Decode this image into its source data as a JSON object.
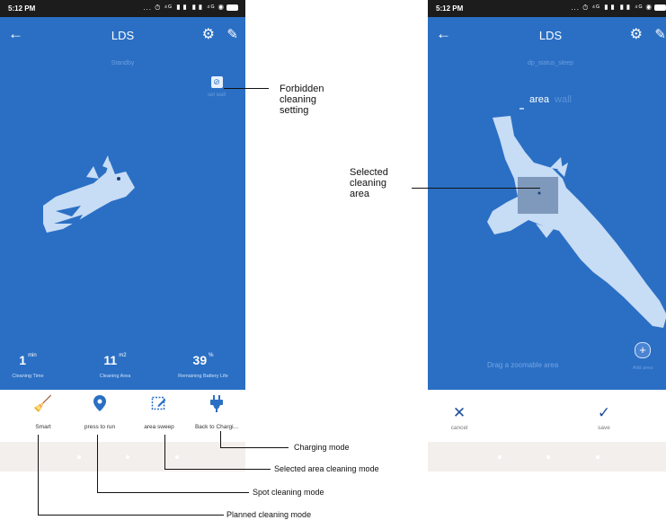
{
  "left_phone": {
    "status_bar": {
      "time": "5:12 PM",
      "icons": "... ⏱ ⁴ᴳ ▮▮ ▮▮ ⁴ᴳ ◉"
    },
    "title_bar": {
      "title": "LDS"
    },
    "status_text": "Standby",
    "set_wall_label": "set wall",
    "stats": [
      {
        "value": "1",
        "unit": "min",
        "label": "Cleaning Time"
      },
      {
        "value": "11",
        "unit": "m2",
        "label": "Cleaning Area"
      },
      {
        "value": "39",
        "unit": "%",
        "label": "Remaining Battery Life"
      }
    ],
    "modes": [
      {
        "label": "Smart",
        "icon": "broom-icon"
      },
      {
        "label": "press to run",
        "icon": "location-pin-icon"
      },
      {
        "label": "area sweep",
        "icon": "area-edit-icon"
      },
      {
        "label": "Back to Chargi...",
        "icon": "plug-icon"
      }
    ]
  },
  "right_phone": {
    "status_bar": {
      "time": "5:12 PM",
      "icons": "... ⏱ ⁴ᴳ ▮▮ ▮▮ ⁴ᴳ ◉"
    },
    "title_bar": {
      "title": "LDS"
    },
    "status_text": "dp_status_sleep",
    "area_tabs": [
      {
        "label": "area",
        "active": true
      },
      {
        "label": "wall",
        "active": false
      }
    ],
    "drag_hint": "Drag a zoomable area",
    "add_area_label": "Add area",
    "actions": [
      {
        "label": "cancel",
        "icon": "close-icon"
      },
      {
        "label": "save",
        "icon": "check-icon"
      }
    ]
  },
  "annotations": {
    "forbidden": "Forbidden\ncleaning\nsetting",
    "selected_area": "Selected\ncleaning\narea",
    "charging": "Charging mode",
    "selected_area_mode": "Selected area cleaning mode",
    "spot": "Spot cleaning mode",
    "planned": "Planned cleaning mode"
  },
  "colors": {
    "screen_blue": "#2a6fc4",
    "map_fill": "#c7dcf5",
    "icon_blue": "#2a6fc4",
    "nav_bg": "#f3efec"
  }
}
